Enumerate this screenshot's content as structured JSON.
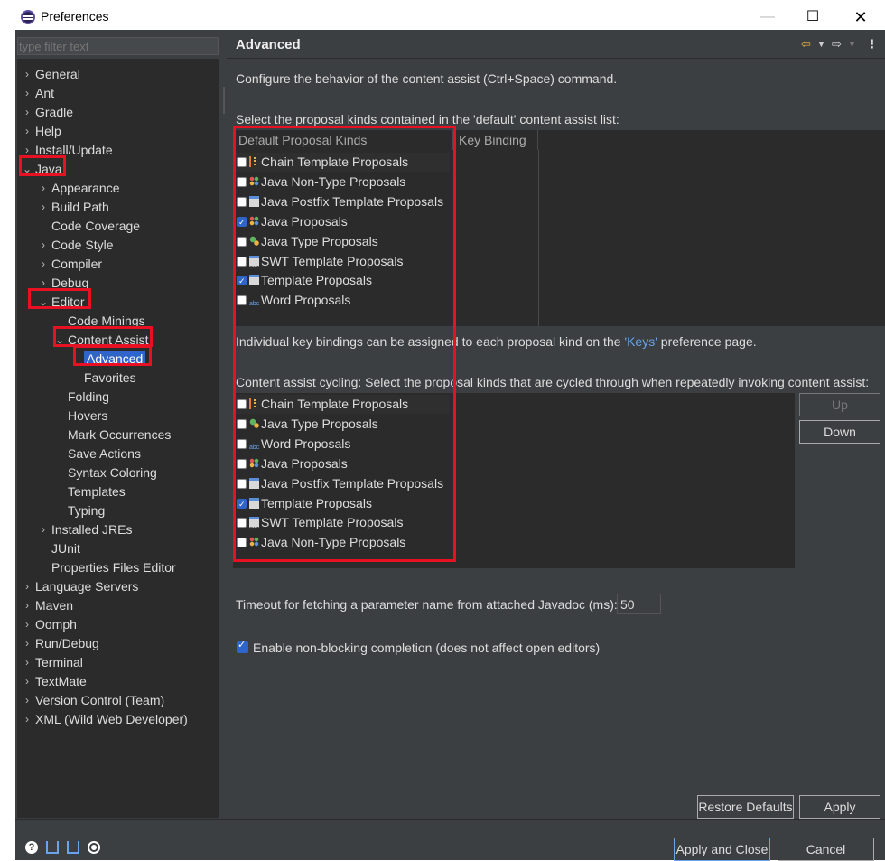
{
  "window": {
    "title": "Preferences",
    "minimize": "—",
    "maximize": "☐",
    "close": "✕"
  },
  "filter": {
    "placeholder": "type filter text"
  },
  "tree": [
    {
      "label": "General",
      "chevron": "›"
    },
    {
      "label": "Ant",
      "chevron": "›"
    },
    {
      "label": "Gradle",
      "chevron": "›"
    },
    {
      "label": "Help",
      "chevron": "›"
    },
    {
      "label": "Install/Update",
      "chevron": "›"
    },
    {
      "label": "Java",
      "chevron": "⌄"
    },
    {
      "label": "Appearance",
      "chevron": "›"
    },
    {
      "label": "Build Path",
      "chevron": "›"
    },
    {
      "label": "Code Coverage",
      "chevron": ""
    },
    {
      "label": "Code Style",
      "chevron": "›"
    },
    {
      "label": "Compiler",
      "chevron": "›"
    },
    {
      "label": "Debug",
      "chevron": "›"
    },
    {
      "label": "Editor",
      "chevron": "⌄"
    },
    {
      "label": "Code Minings",
      "chevron": ""
    },
    {
      "label": "Content Assist",
      "chevron": "⌄"
    },
    {
      "label": "Advanced",
      "chevron": ""
    },
    {
      "label": "Favorites",
      "chevron": ""
    },
    {
      "label": "Folding",
      "chevron": ""
    },
    {
      "label": "Hovers",
      "chevron": ""
    },
    {
      "label": "Mark Occurrences",
      "chevron": ""
    },
    {
      "label": "Save Actions",
      "chevron": ""
    },
    {
      "label": "Syntax Coloring",
      "chevron": ""
    },
    {
      "label": "Templates",
      "chevron": ""
    },
    {
      "label": "Typing",
      "chevron": ""
    },
    {
      "label": "Installed JREs",
      "chevron": "›"
    },
    {
      "label": "JUnit",
      "chevron": ""
    },
    {
      "label": "Properties Files Editor",
      "chevron": ""
    },
    {
      "label": "Language Servers",
      "chevron": "›"
    },
    {
      "label": "Maven",
      "chevron": "›"
    },
    {
      "label": "Oomph",
      "chevron": "›"
    },
    {
      "label": "Run/Debug",
      "chevron": "›"
    },
    {
      "label": "Terminal",
      "chevron": "›"
    },
    {
      "label": "TextMate",
      "chevron": "›"
    },
    {
      "label": "Version Control (Team)",
      "chevron": "›"
    },
    {
      "label": "XML (Wild Web Developer)",
      "chevron": "›"
    }
  ],
  "page": {
    "title": "Advanced",
    "nav": {
      "back": "⇦",
      "back_dd": "▼",
      "forward": "⇨",
      "forward_dd": "▼",
      "menu": "⋮"
    },
    "description": "Configure the behavior of the content assist (Ctrl+Space) command.",
    "default_list_label": "Select the proposal kinds contained in the 'default' content assist list:",
    "col_kinds": "Default Proposal Kinds",
    "col_binding": "Key Binding",
    "default_kinds": [
      {
        "label": "Chain Template Proposals",
        "checked": false,
        "icon": "chain-template-icon"
      },
      {
        "label": "Java Non-Type Proposals",
        "checked": false,
        "icon": "java-non-type-icon"
      },
      {
        "label": "Java Postfix Template Proposals",
        "checked": false,
        "icon": "template-icon"
      },
      {
        "label": "Java Proposals",
        "checked": true,
        "icon": "java-proposals-icon"
      },
      {
        "label": "Java Type Proposals",
        "checked": false,
        "icon": "java-type-icon"
      },
      {
        "label": "SWT Template Proposals",
        "checked": false,
        "icon": "swt-template-icon"
      },
      {
        "label": "Template Proposals",
        "checked": true,
        "icon": "template-icon"
      },
      {
        "label": "Word Proposals",
        "checked": false,
        "icon": "word-icon"
      }
    ],
    "keys_text_before": "Individual key bindings can be assigned to each proposal kind on the ",
    "keys_link": "'Keys'",
    "keys_text_after": " preference page.",
    "cycling_label": "Content assist cycling: Select the proposal kinds that are cycled through when repeatedly invoking content assist:",
    "cycling_kinds": [
      {
        "label": "Chain Template Proposals",
        "checked": false,
        "icon": "chain-template-icon"
      },
      {
        "label": "Java Type Proposals",
        "checked": false,
        "icon": "java-type-icon"
      },
      {
        "label": "Word Proposals",
        "checked": false,
        "icon": "word-icon"
      },
      {
        "label": "Java Proposals",
        "checked": false,
        "icon": "java-proposals-icon"
      },
      {
        "label": "Java Postfix Template Proposals",
        "checked": false,
        "icon": "template-icon"
      },
      {
        "label": "Template Proposals",
        "checked": true,
        "icon": "template-icon"
      },
      {
        "label": "SWT Template Proposals",
        "checked": false,
        "icon": "swt-template-icon"
      },
      {
        "label": "Java Non-Type Proposals",
        "checked": false,
        "icon": "java-non-type-icon"
      }
    ],
    "up_label": "Up",
    "down_label": "Down",
    "timeout_label": "Timeout for fetching a parameter name from attached Javadoc (ms):",
    "timeout_value": "50",
    "nonblocking_label": "Enable non-blocking completion (does not affect open editors)",
    "nonblocking_checked": true,
    "restore_label": "Restore Defaults",
    "apply_label": "Apply"
  },
  "footer": {
    "apply_close_label": "Apply and Close",
    "cancel_label": "Cancel",
    "help_glyph": "?"
  },
  "colors": {
    "selection": "#2f65ca",
    "annotation_red": "#e81123",
    "link": "#6ba3e8",
    "background": "#3c3f41"
  }
}
